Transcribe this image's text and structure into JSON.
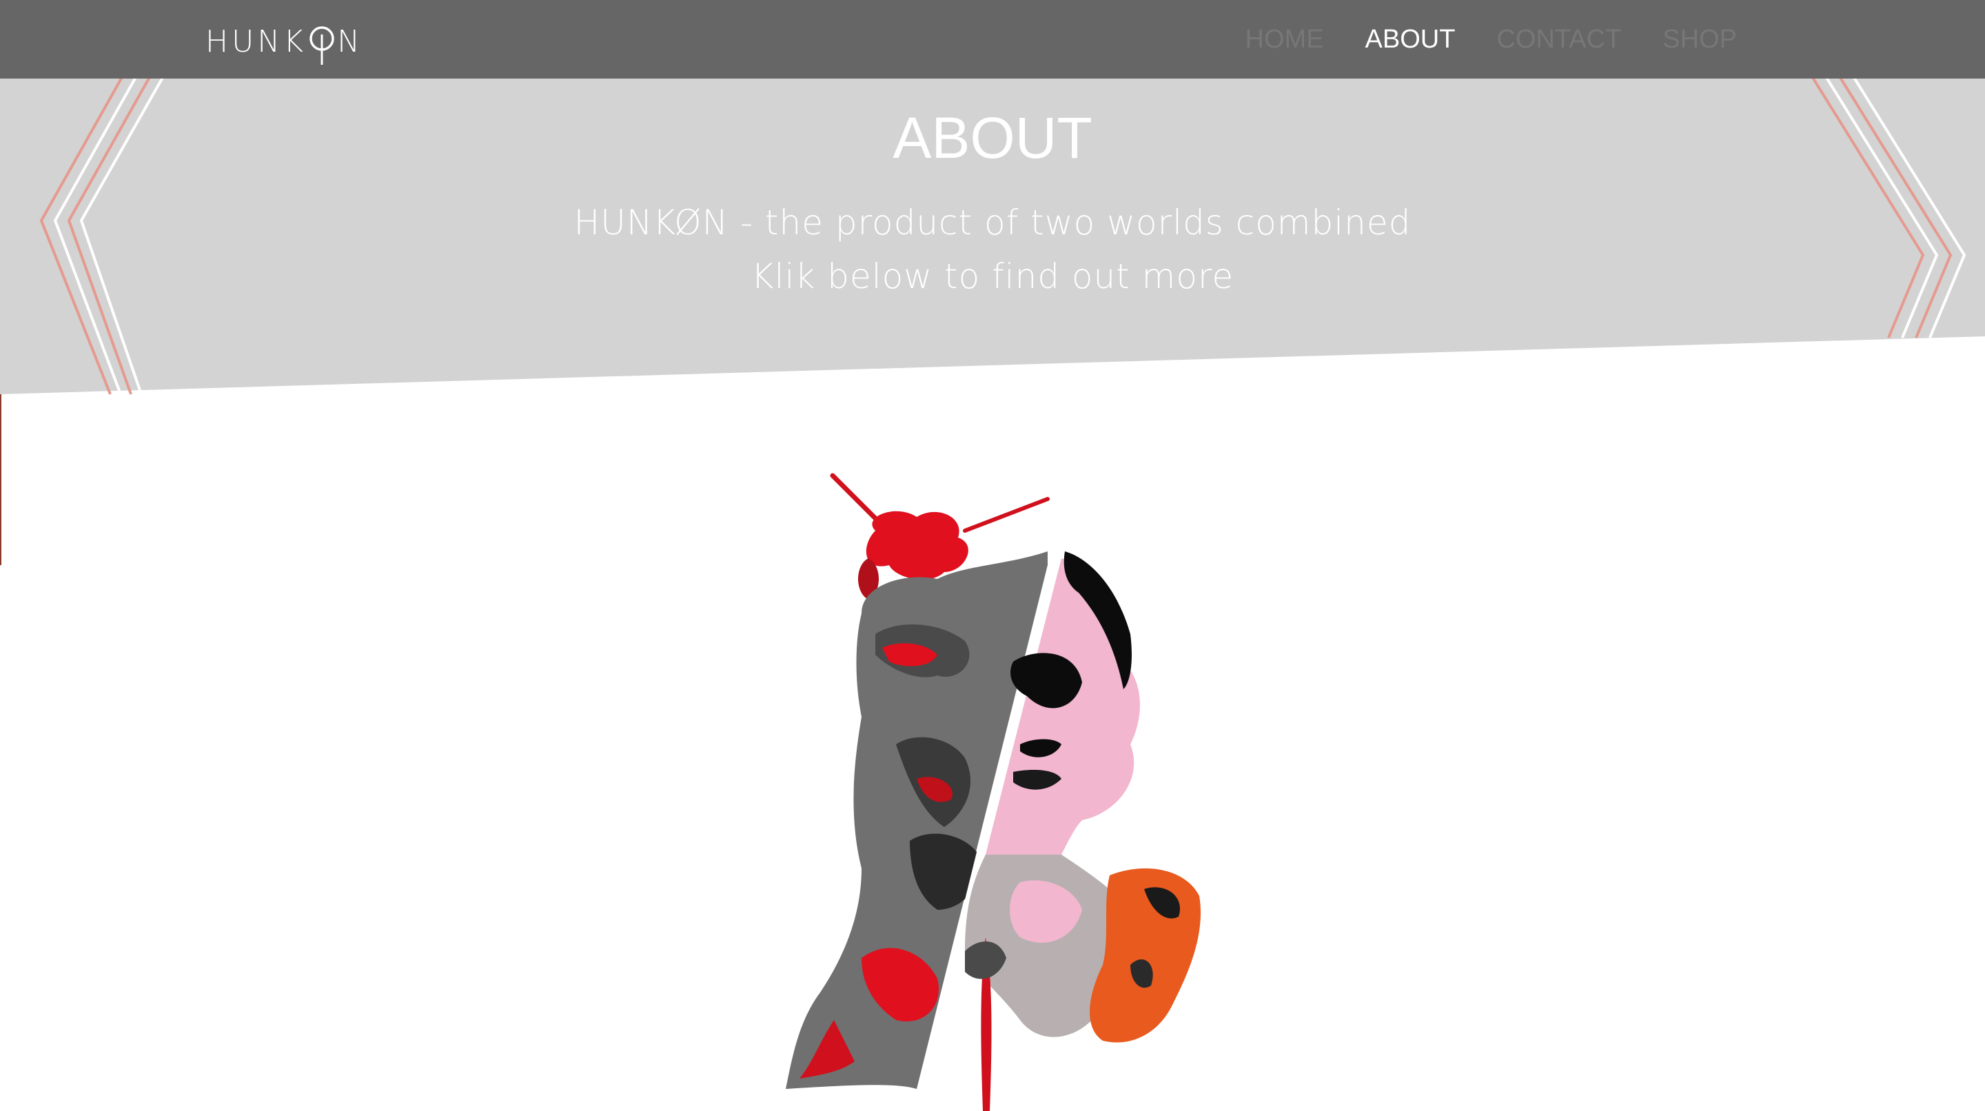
{
  "brand": {
    "logo_text_left": "HUNK",
    "logo_text_right": "N",
    "logo_symbol": "hunkon-o-glyph"
  },
  "nav": {
    "items": [
      {
        "label": "HOME",
        "active": false
      },
      {
        "label": "ABOUT",
        "active": true
      },
      {
        "label": "CONTACT",
        "active": false
      },
      {
        "label": "SHOP",
        "active": false
      }
    ]
  },
  "hero": {
    "title": "ABOUT",
    "subtitle_line1": "HUNKØN - the product of two worlds combined",
    "subtitle_line2": "Klik below to find out more"
  },
  "artwork": {
    "description_icon": "split-portrait-illustration"
  },
  "colors": {
    "navbar": "#666666",
    "hero": "#d3d3d3",
    "accent_red": "#e0101e",
    "accent_orange": "#e85a1e",
    "accent_pink": "#f2b6cf",
    "nav_inactive": "#777777",
    "nav_active": "#ffffff"
  }
}
